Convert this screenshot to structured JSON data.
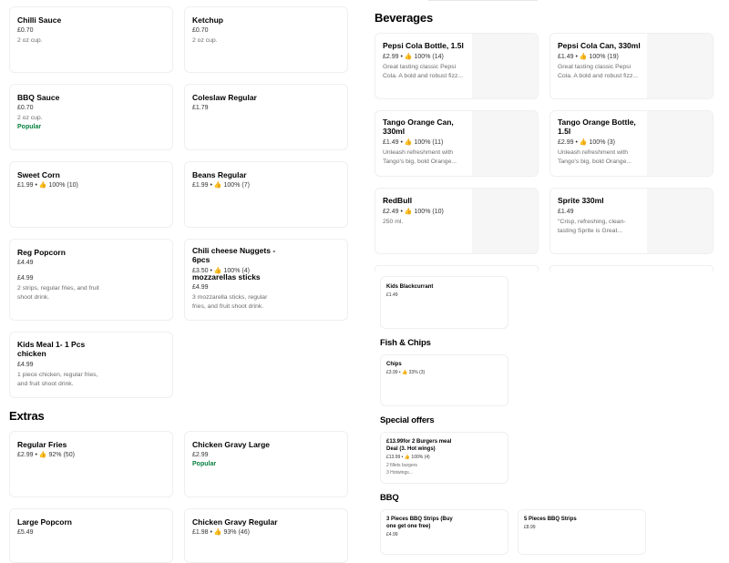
{
  "left": {
    "cards": [
      {
        "name": "Chilli Sauce",
        "line": "£0.70",
        "desc": "2 oz cup."
      },
      {
        "name": "Ketchup",
        "line": "£0.70",
        "desc": "2 oz cup."
      },
      {
        "name": "BBQ Sauce",
        "line": "£0.70",
        "desc": "2 oz cup.",
        "popular": "Popular"
      },
      {
        "name": "Coleslaw Regular",
        "line": "£1.79"
      },
      {
        "name": "Sweet Corn",
        "line": "£1.99 • 👍 100% (10)"
      },
      {
        "name": "Beans Regular",
        "line": "£1.99 • 👍 100% (7)"
      },
      {
        "name": "Reg Popcorn",
        "line": "£4.49",
        "line2": "£4.99",
        "desc": "2 strips, regular fries, and fruit shoot drink."
      },
      {
        "name": "Chili cheese Nuggets - 6pcs",
        "line": "£3.50 • 👍 100% (4)",
        "overlap_name": "mozzarellas sticks",
        "line2": "£4.99",
        "desc": "3 mozzarella sticks, regular fries, and fruit shoot drink."
      },
      {
        "name": "Kids Meal 1- 1 Pcs chicken",
        "line": "£4.99",
        "desc": "1 piece chicken, regular fries, and fruit shoot drink."
      }
    ],
    "extras_title": "Extras",
    "extras": [
      {
        "name": "Regular Fries",
        "line": "£2.99 • 👍 92% (50)"
      },
      {
        "name": "Chicken Gravy Large",
        "line": "£2.99",
        "popular": "Popular"
      },
      {
        "name": "Large Popcorn",
        "line": "£5.49"
      },
      {
        "name": "Chicken Gravy Regular",
        "line": "£1.98 • 👍 93% (46)"
      }
    ]
  },
  "right": {
    "beverages_title": "Beverages",
    "beverages": [
      {
        "name": "Pepsi Cola Bottle, 1.5l",
        "line": "£2.99 • 👍 100% (14)",
        "desc": "Great tasting classic Pepsi Cola. A bold and robust fizz..."
      },
      {
        "name": "Pepsi Cola Can, 330ml",
        "line": "£1.49 • 👍 100% (19)",
        "desc": "Great tasting classic Pepsi Cola. A bold and robust fizz..."
      },
      {
        "name": "Tango Orange Can, 330ml",
        "line": "£1.49 • 👍 100% (11)",
        "desc": "Unleash refreshment with Tango's big, bold Orange..."
      },
      {
        "name": "Tango Orange Bottle, 1.5l",
        "line": "£2.99 • 👍 100% (3)",
        "desc": "Unleash refreshment with Tango's big, bold Orange..."
      },
      {
        "name": "RedBull",
        "line": "£2.49 • 👍 100% (10)",
        "desc": "250 ml."
      },
      {
        "name": "Sprite 330ml",
        "line": "£1.49",
        "desc": "\"Crisp, refreshing, clean-tasting Sprite is Great..."
      }
    ],
    "kids_blackcurrant": {
      "name": "Kids Blackcurrant",
      "line": "£1.49"
    },
    "fish_title": "Fish & Chips",
    "chips": {
      "name": "Chips",
      "line": "£3.99 • 👍 33% (3)"
    },
    "offers_title": "Special offers",
    "offer": {
      "name": "£13.99for 2 Burgers meal Deal (3. Hot wings)",
      "line": "£13.99 • 👍 100% (4)",
      "desc1": "2 fillets burgers",
      "desc2": "3 Hotwings..."
    },
    "bbq_title": "BBQ",
    "bbq": [
      {
        "name": "3 Pieces BBQ Strips (Buy one get one free)",
        "line": "£4.99"
      },
      {
        "name": "5 Pieces BBQ Strips",
        "line": "£8.99"
      }
    ]
  }
}
